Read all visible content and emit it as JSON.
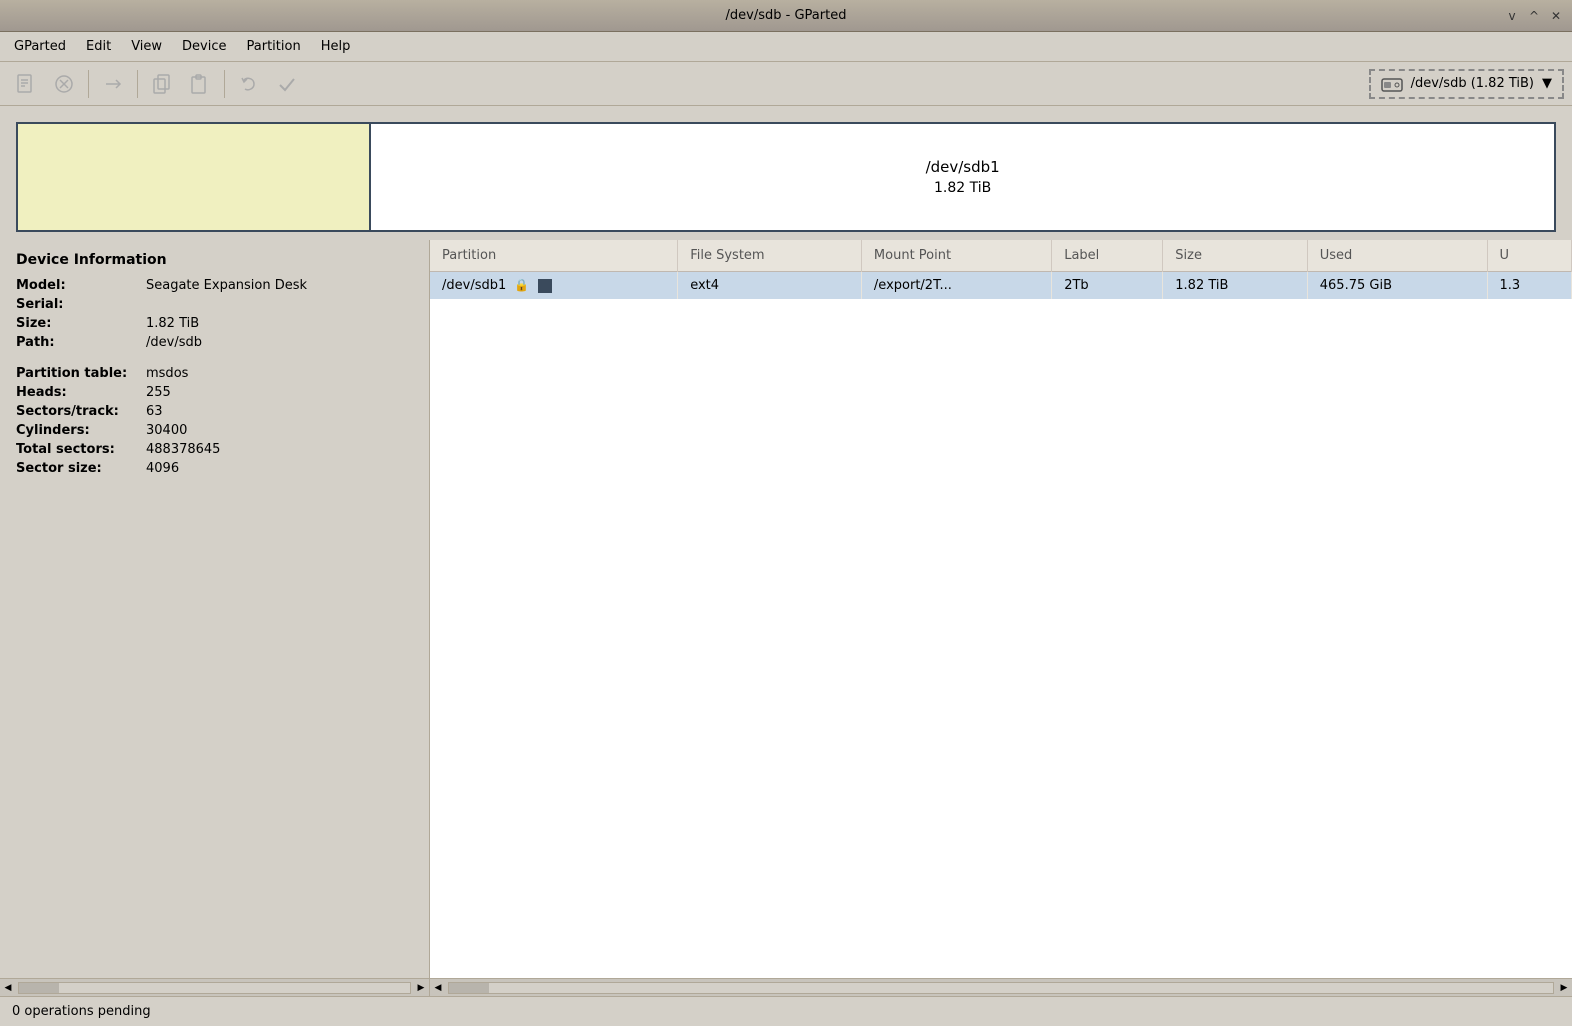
{
  "titlebar": {
    "title": "/dev/sdb - GParted",
    "minimize": "v",
    "maximize": "^",
    "close": "✕"
  },
  "menubar": {
    "items": [
      "GParted",
      "Edit",
      "View",
      "Device",
      "Partition",
      "Help"
    ]
  },
  "toolbar": {
    "buttons": [
      {
        "name": "new",
        "icon": "📄",
        "disabled": true
      },
      {
        "name": "delete",
        "icon": "⊗",
        "disabled": true
      },
      {
        "name": "resize",
        "icon": "→",
        "disabled": true
      },
      {
        "name": "copy",
        "icon": "⧉",
        "disabled": true
      },
      {
        "name": "paste",
        "icon": "📋",
        "disabled": true
      },
      {
        "name": "undo",
        "icon": "↩",
        "disabled": true
      },
      {
        "name": "apply",
        "icon": "✓",
        "disabled": true
      }
    ],
    "device_selector": {
      "icon": "💾",
      "label": "/dev/sdb  (1.82 TiB)",
      "arrow": "▼"
    }
  },
  "partition_visual": {
    "partition_name": "/dev/sdb1",
    "partition_size": "1.82 TiB"
  },
  "device_info": {
    "title": "Device Information",
    "fields": [
      {
        "label": "Model:",
        "value": "Seagate Expansion Desk"
      },
      {
        "label": "Serial:",
        "value": ""
      },
      {
        "label": "Size:",
        "value": "1.82 TiB"
      },
      {
        "label": "Path:",
        "value": "/dev/sdb"
      },
      {
        "label": "",
        "value": ""
      },
      {
        "label": "Partition table:",
        "value": "msdos"
      },
      {
        "label": "Heads:",
        "value": "255"
      },
      {
        "label": "Sectors/track:",
        "value": "63"
      },
      {
        "label": "Cylinders:",
        "value": "30400"
      },
      {
        "label": "Total sectors:",
        "value": "488378645"
      },
      {
        "label": "Sector size:",
        "value": "4096"
      }
    ]
  },
  "partition_table": {
    "columns": [
      "Partition",
      "File System",
      "Mount Point",
      "Label",
      "Size",
      "Used",
      "U"
    ],
    "rows": [
      {
        "partition": "/dev/sdb1",
        "has_lock": true,
        "has_color": true,
        "filesystem": "ext4",
        "mount_point": "/export/2T...",
        "label": "2Tb",
        "size": "1.82 TiB",
        "used": "465.75 GiB",
        "unused": "1.3"
      }
    ]
  },
  "statusbar": {
    "text": "0 operations pending"
  }
}
